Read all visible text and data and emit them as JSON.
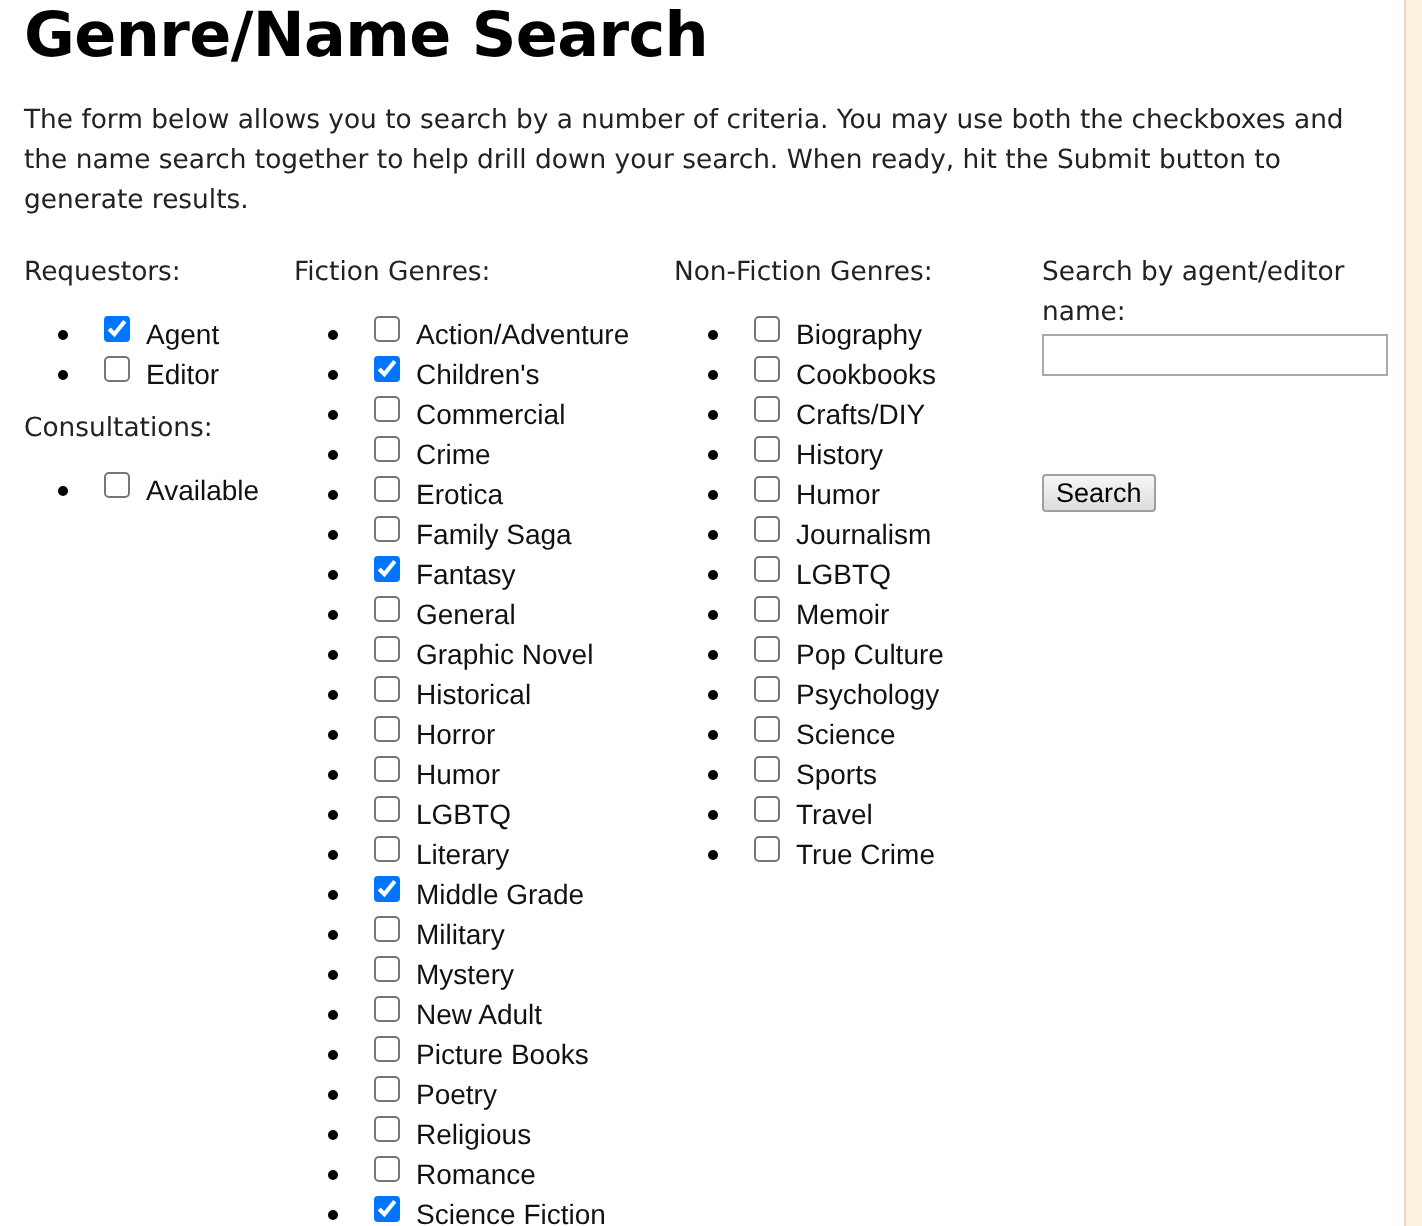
{
  "title": "Genre/Name Search",
  "intro": "The form below allows you to search by a number of criteria. You may use both the checkboxes and the name search together to help drill down your search. When ready, hit the Submit button to generate results.",
  "columns": [
    {
      "groups": [
        {
          "heading": "Requestors:",
          "items": [
            {
              "label": "Agent",
              "checked": true
            },
            {
              "label": "Editor",
              "checked": false
            }
          ]
        },
        {
          "heading": "Consultations:",
          "items": [
            {
              "label": "Available",
              "checked": false
            }
          ]
        }
      ]
    },
    {
      "groups": [
        {
          "heading": "Fiction Genres:",
          "items": [
            {
              "label": "Action/Adventure",
              "checked": false
            },
            {
              "label": "Children's",
              "checked": true
            },
            {
              "label": "Commercial",
              "checked": false
            },
            {
              "label": "Crime",
              "checked": false
            },
            {
              "label": "Erotica",
              "checked": false
            },
            {
              "label": "Family Saga",
              "checked": false
            },
            {
              "label": "Fantasy",
              "checked": true
            },
            {
              "label": "General",
              "checked": false
            },
            {
              "label": "Graphic Novel",
              "checked": false
            },
            {
              "label": "Historical",
              "checked": false
            },
            {
              "label": "Horror",
              "checked": false
            },
            {
              "label": "Humor",
              "checked": false
            },
            {
              "label": "LGBTQ",
              "checked": false
            },
            {
              "label": "Literary",
              "checked": false
            },
            {
              "label": "Middle Grade",
              "checked": true
            },
            {
              "label": "Military",
              "checked": false
            },
            {
              "label": "Mystery",
              "checked": false
            },
            {
              "label": "New Adult",
              "checked": false
            },
            {
              "label": "Picture Books",
              "checked": false
            },
            {
              "label": "Poetry",
              "checked": false
            },
            {
              "label": "Religious",
              "checked": false
            },
            {
              "label": "Romance",
              "checked": false
            },
            {
              "label": "Science Fiction",
              "checked": true
            }
          ]
        }
      ]
    },
    {
      "groups": [
        {
          "heading": "Non-Fiction Genres:",
          "items": [
            {
              "label": "Biography",
              "checked": false
            },
            {
              "label": "Cookbooks",
              "checked": false
            },
            {
              "label": "Crafts/DIY",
              "checked": false
            },
            {
              "label": "History",
              "checked": false
            },
            {
              "label": "Humor",
              "checked": false
            },
            {
              "label": "Journalism",
              "checked": false
            },
            {
              "label": "LGBTQ",
              "checked": false
            },
            {
              "label": "Memoir",
              "checked": false
            },
            {
              "label": "Pop Culture",
              "checked": false
            },
            {
              "label": "Psychology",
              "checked": false
            },
            {
              "label": "Science",
              "checked": false
            },
            {
              "label": "Sports",
              "checked": false
            },
            {
              "label": "Travel",
              "checked": false
            },
            {
              "label": "True Crime",
              "checked": false
            }
          ]
        }
      ]
    }
  ],
  "name_search": {
    "label": "Search by agent/editor name:",
    "button": "Search"
  }
}
